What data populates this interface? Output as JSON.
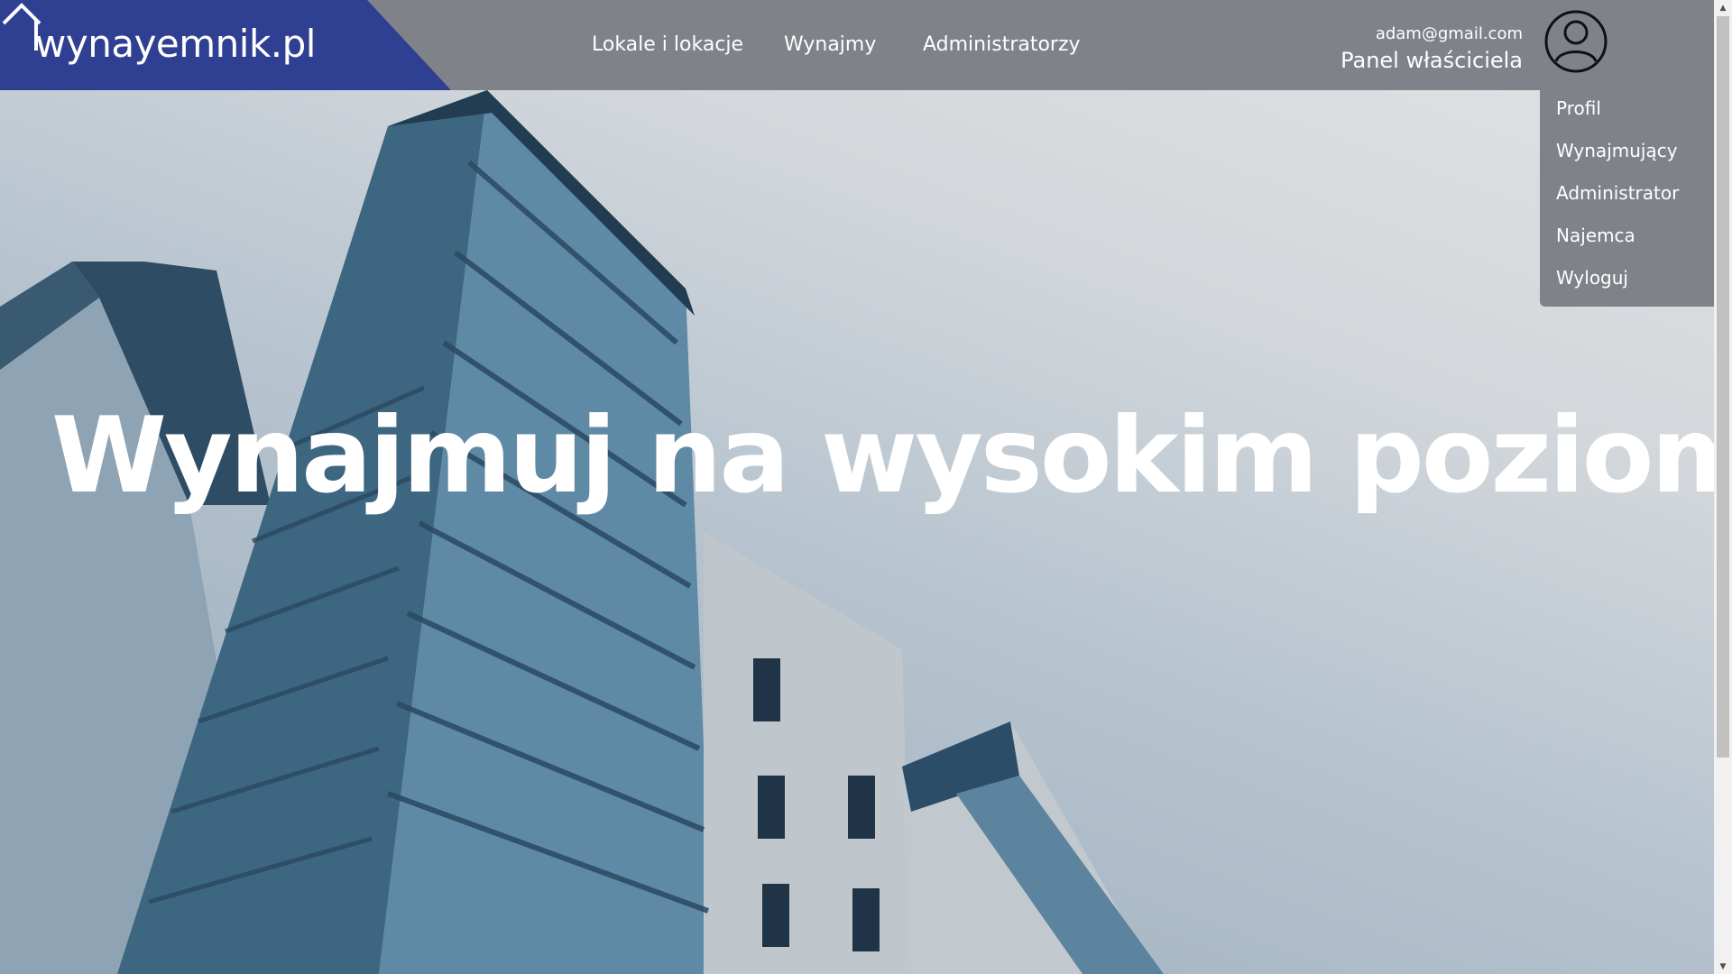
{
  "header": {
    "logo_text": "wynayemnik.pl",
    "nav": [
      {
        "label": "Lokale i lokacje"
      },
      {
        "label": "Wynajmy"
      },
      {
        "label": "Administratorzy"
      }
    ],
    "user": {
      "email": "adam@gmail.com",
      "panel_label": "Panel właściciela"
    }
  },
  "dropdown": {
    "items": [
      {
        "label": "Profil"
      },
      {
        "label": "Wynajmujący"
      },
      {
        "label": "Administrator"
      },
      {
        "label": "Najemca"
      },
      {
        "label": "Wyloguj"
      }
    ]
  },
  "hero": {
    "headline": "Wynajmuj na wysokim poziomie"
  },
  "colors": {
    "logo_bg": "#2f3f91",
    "header_bg": "#808289",
    "text": "#ffffff"
  },
  "icons": {
    "avatar": "user-circle-icon",
    "logo_mark": "house-outline-icon"
  }
}
